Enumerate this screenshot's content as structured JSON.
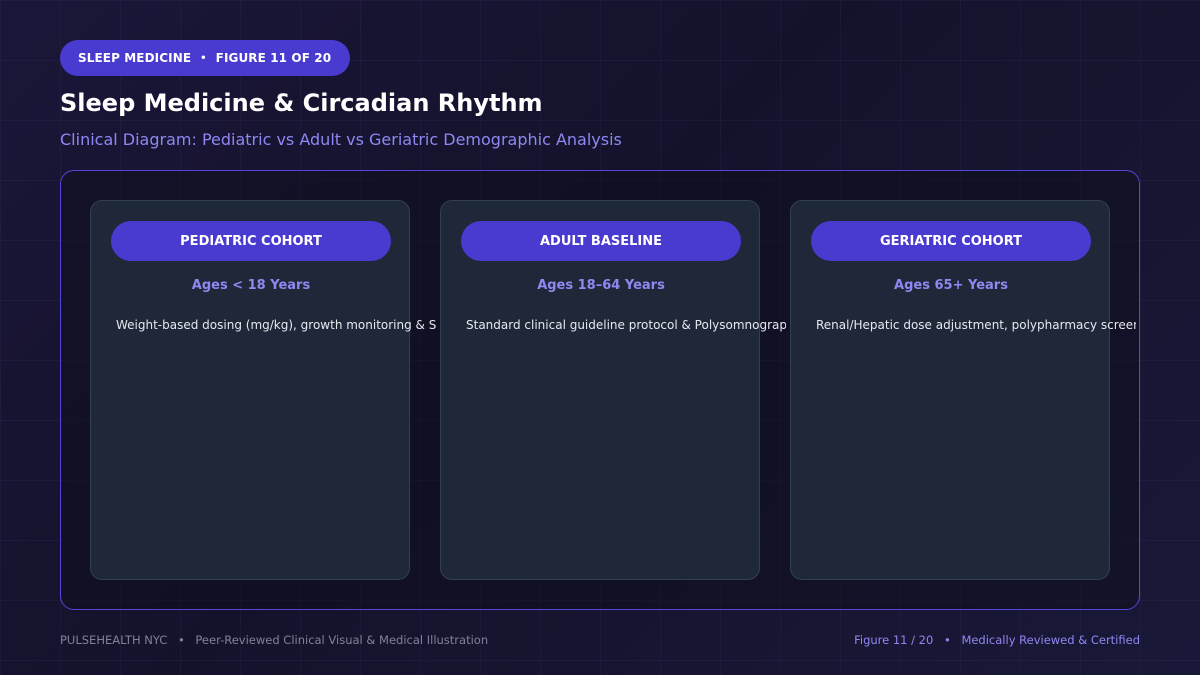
{
  "header": {
    "pill_category": "SLEEP MEDICINE",
    "pill_separator": "•",
    "pill_figure": "FIGURE 11 OF 20",
    "title": "Sleep Medicine & Circadian Rhythm",
    "subtitle": "Clinical Diagram: Pediatric vs Adult vs Geriatric Demographic Analysis"
  },
  "cards": [
    {
      "title": "PEDIATRIC COHORT",
      "ages": "Ages < 18 Years",
      "description": "Weight-based dosing (mg/kg), growth monitoring & SCI"
    },
    {
      "title": "ADULT BASELINE",
      "ages": "Ages 18–64 Years",
      "description": "Standard clinical guideline protocol & Polysomnography"
    },
    {
      "title": "GERIATRIC COHORT",
      "ages": "Ages 65+ Years",
      "description": "Renal/Hepatic dose adjustment, polypharmacy screening & CBT-I"
    }
  ],
  "footer": {
    "brand": "PULSEHEALTH NYC",
    "separator": "•",
    "tagline": "Peer-Reviewed Clinical Visual & Medical Illustration",
    "figure": "Figure 11 / 20",
    "certification": "Medically Reviewed & Certified"
  },
  "colors": {
    "accent": "#4a3bd0",
    "accent_text": "#8f88f2",
    "card_bg": "#1f2838",
    "page_bg": "#14122b"
  }
}
